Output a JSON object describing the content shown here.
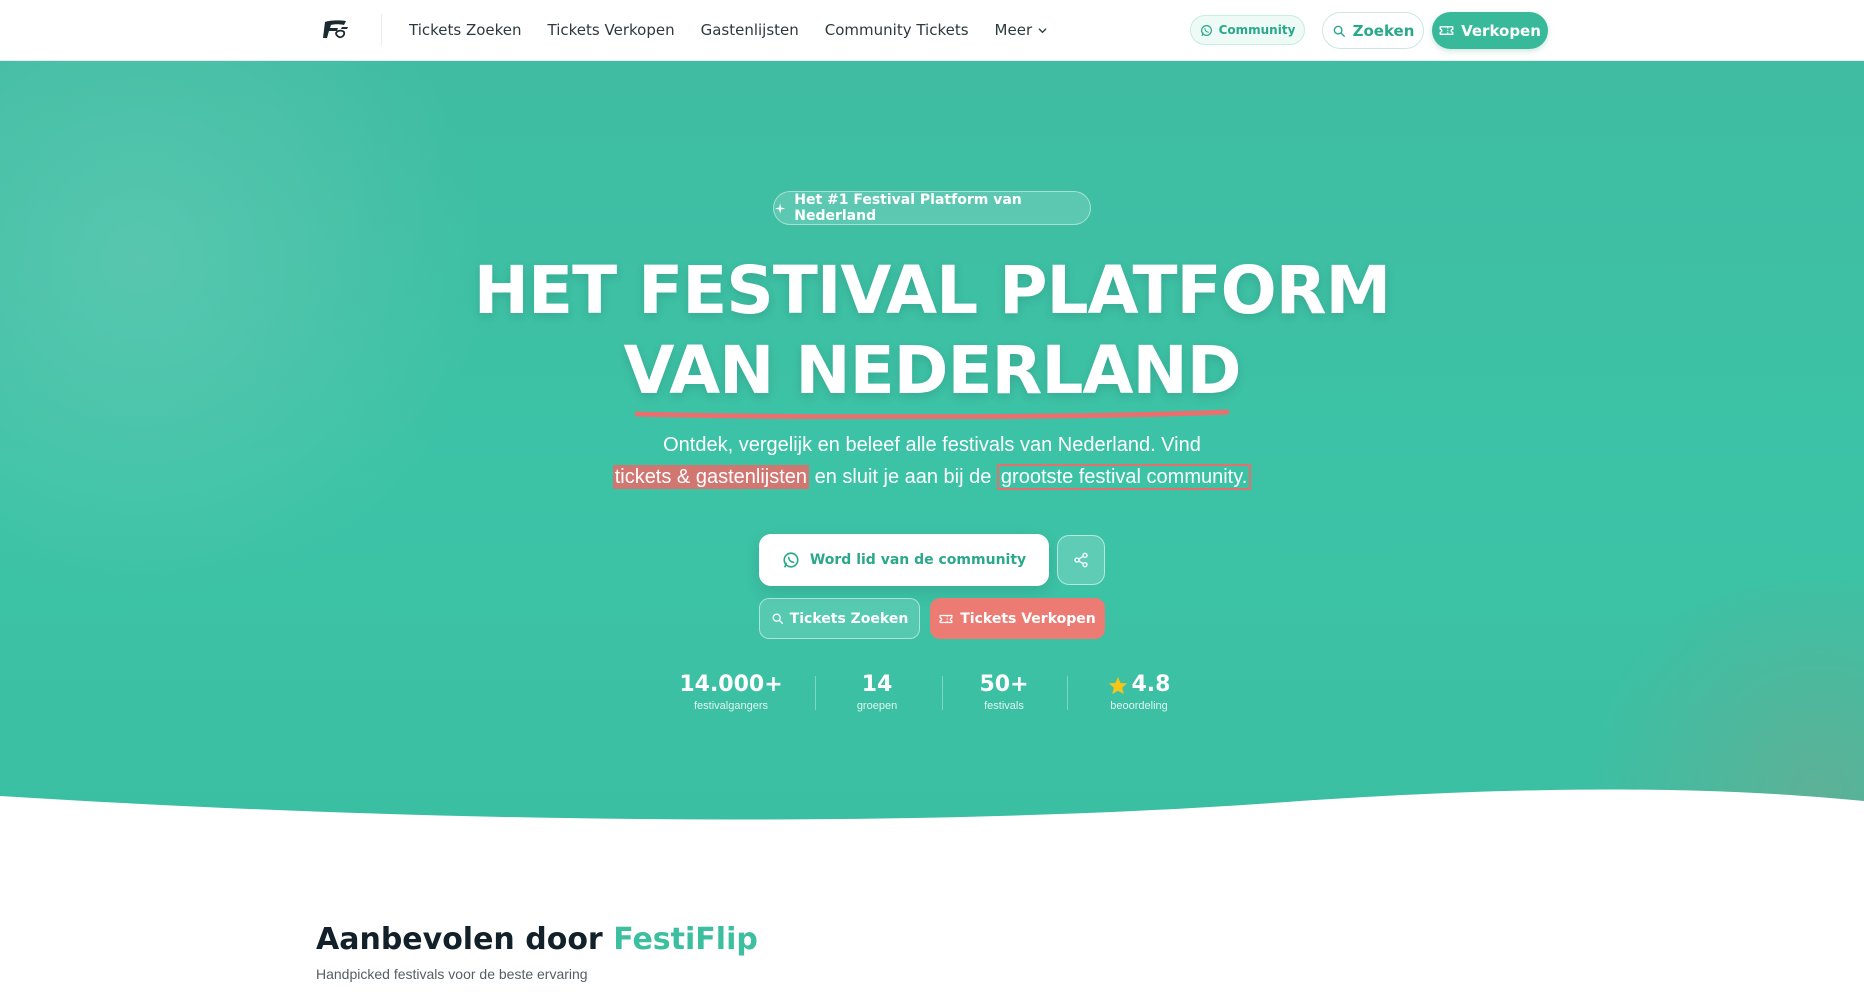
{
  "nav": {
    "logo_text": "Festi",
    "links": [
      "Tickets Zoeken",
      "Tickets Verkopen",
      "Gastenlijsten",
      "Community Tickets"
    ],
    "more_label": "Meer",
    "community_label": "Community",
    "search_label": "Zoeken",
    "sell_label": "Verkopen"
  },
  "hero": {
    "badge": "Het #1 Festival Platform van Nederland",
    "title_line1": "HET FESTIVAL PLATFORM",
    "title_line2": "VAN NEDERLAND",
    "subtitle_part1": "Ontdek, vergelijk en beleef alle festivals van Nederland. Vind",
    "subtitle_highlight1": "tickets & gastenlijsten",
    "subtitle_part2": " en sluit je aan bij de ",
    "subtitle_highlight2": "grootste festival community.",
    "community_button": "Word lid van de community",
    "tickets_search_button": "Tickets Zoeken",
    "tickets_sell_button": "Tickets Verkopen"
  },
  "stats": [
    {
      "value": "14.000+",
      "label": "festivalgangers"
    },
    {
      "value": "14",
      "label": "groepen"
    },
    {
      "value": "50+",
      "label": "festivals"
    },
    {
      "value": "4.8",
      "label": "beoordeling"
    }
  ],
  "recommended": {
    "title_prefix": "Aanbevolen door ",
    "title_brand": "FestiFlip",
    "subtitle": "Handpicked festivals voor de beste ervaring"
  },
  "colors": {
    "primary": "#38b99a",
    "accent_red": "#ec7b73",
    "star": "#f5c518"
  }
}
